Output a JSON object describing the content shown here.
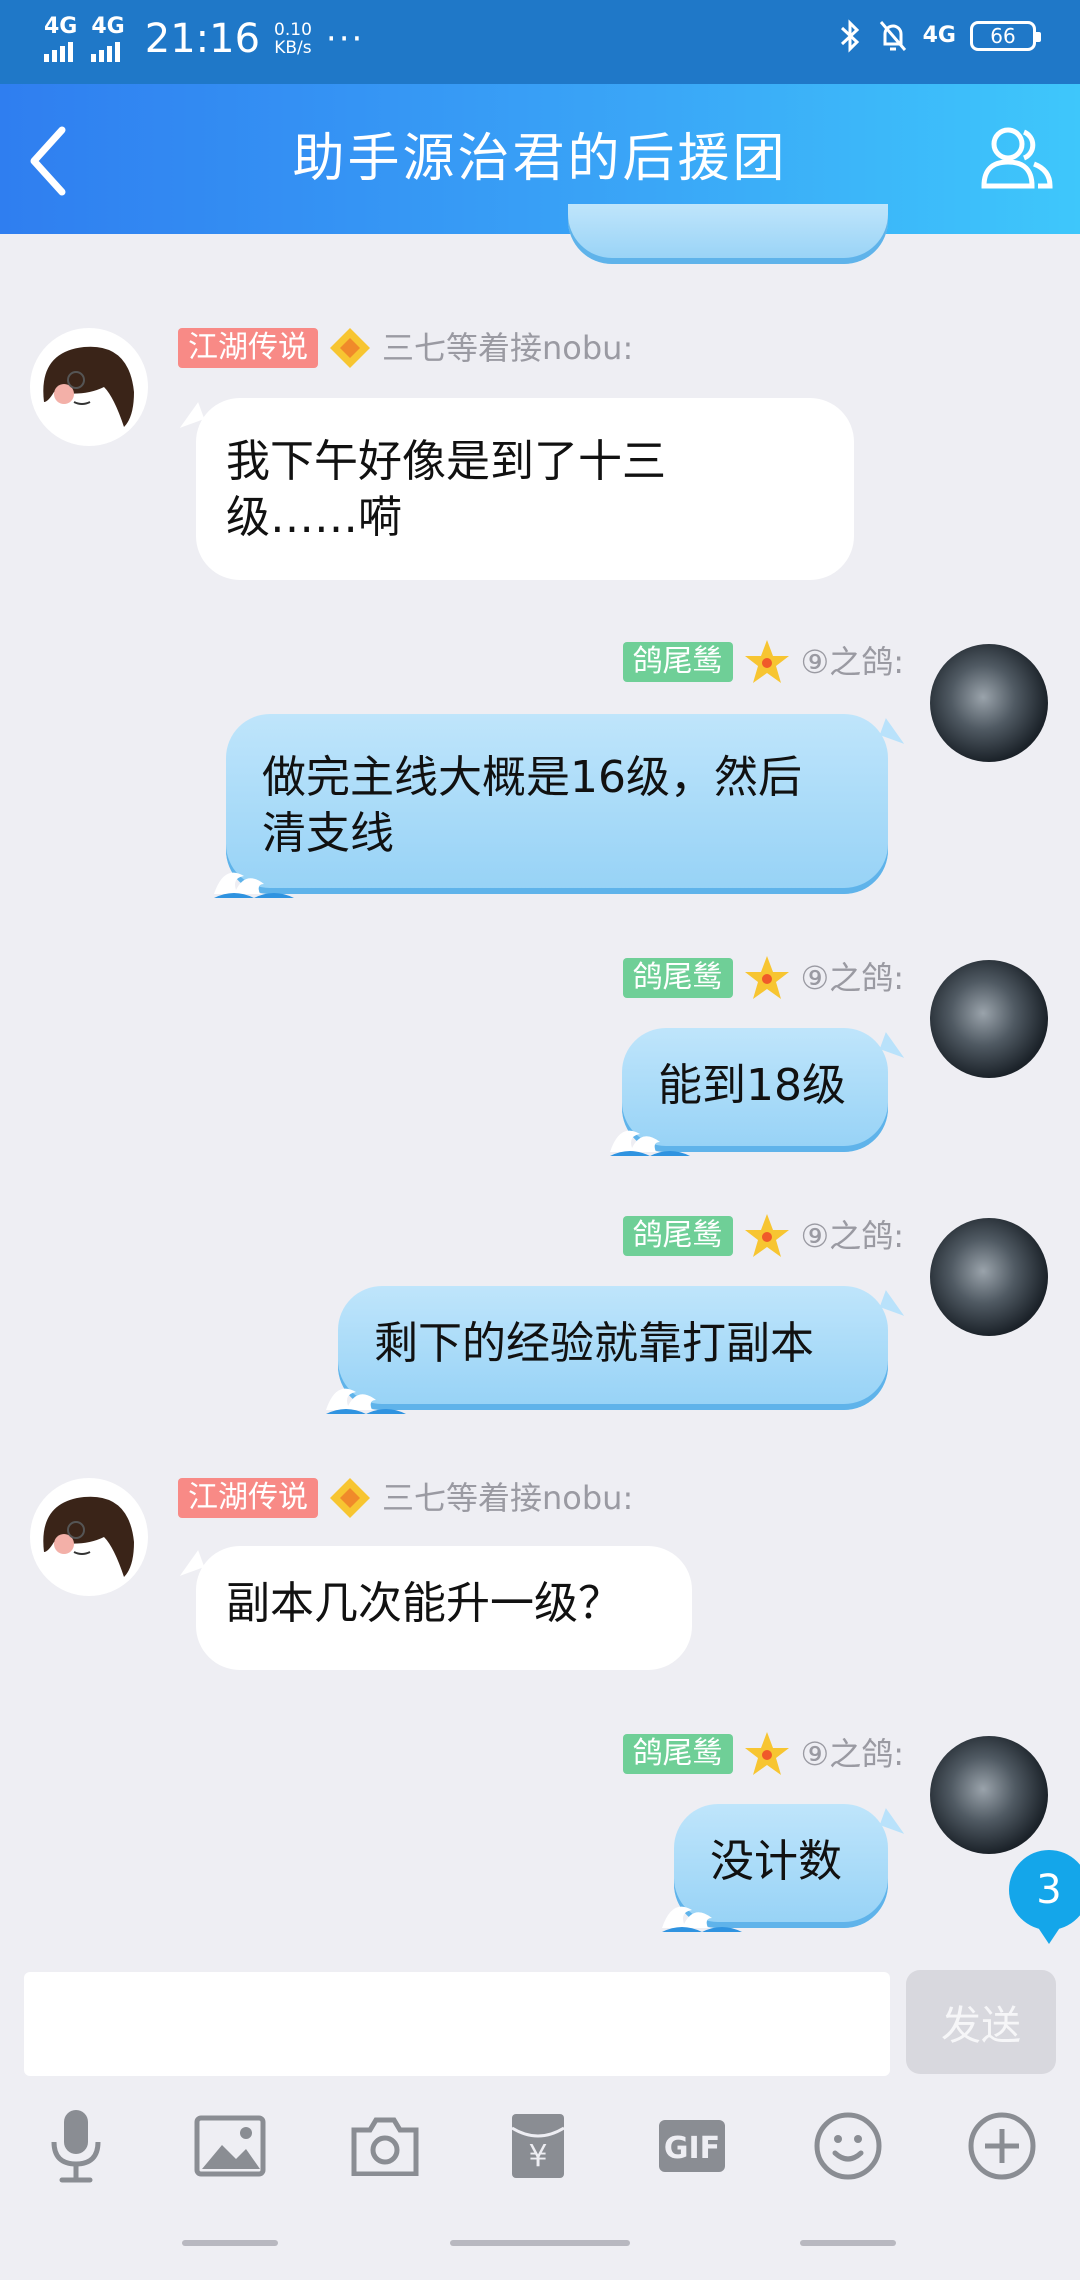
{
  "status_bar": {
    "network_1": "4G",
    "network_2": "4G",
    "time": "21:16",
    "speed_value": "0.10",
    "speed_unit": "KB/s",
    "more": "···",
    "right_network": "4G",
    "battery": "66",
    "icons": [
      "bluetooth-icon",
      "bell-muted-icon",
      "signal-icon"
    ]
  },
  "header": {
    "title": "助手源治君的后援团",
    "back_icon": "chevron-left-icon",
    "profile_icon": "group-members-icon"
  },
  "messages": [
    {
      "side": "left",
      "badge": "江湖传说",
      "badge_icon": "diamond-icon",
      "nickname": "三七等着接nobu:",
      "text_line1": "我下午好像是到了十三",
      "text_line2": "级……嗬"
    },
    {
      "side": "right",
      "badge": "鸽尾鸶",
      "badge_icon": "star-icon",
      "nickname": "⑨之鸽:",
      "text_line1": "做完主线大概是16级，然后",
      "text_line2": "清支线"
    },
    {
      "side": "right",
      "badge": "鸽尾鸶",
      "badge_icon": "star-icon",
      "nickname": "⑨之鸽:",
      "text": "能到18级"
    },
    {
      "side": "right",
      "badge": "鸽尾鸶",
      "badge_icon": "star-icon",
      "nickname": "⑨之鸽:",
      "text": "剩下的经验就靠打副本"
    },
    {
      "side": "left",
      "badge": "江湖传说",
      "badge_icon": "diamond-icon",
      "nickname": "三七等着接nobu:",
      "text": "副本几次能升一级？"
    },
    {
      "side": "right",
      "badge": "鸽尾鸶",
      "badge_icon": "star-icon",
      "nickname": "⑨之鸽:",
      "text": "没计数"
    }
  ],
  "unread_count": "3",
  "input": {
    "placeholder": "",
    "value": "",
    "send_label": "发送"
  },
  "toolbar": {
    "items": [
      "microphone-icon",
      "image-icon",
      "camera-icon",
      "red-packet-icon",
      "gif-icon",
      "emoji-icon",
      "plus-icon"
    ],
    "gif_label": "GIF",
    "red_packet_symbol": "¥"
  },
  "colors": {
    "header_start": "#2f7ef0",
    "header_end": "#3ec7fb",
    "bubble_blue": "#9fd6f7",
    "badge_red": "#f88a86",
    "badge_green": "#6fcf97",
    "unread": "#14a6ea"
  }
}
